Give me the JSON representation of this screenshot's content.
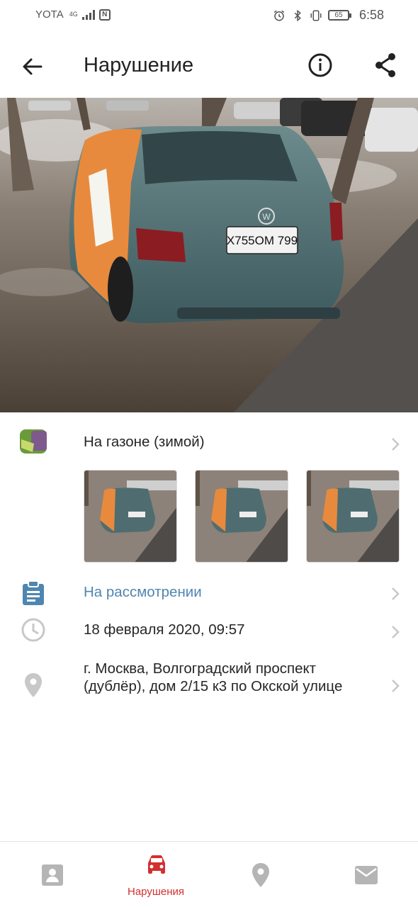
{
  "status_bar": {
    "carrier": "YOTA",
    "network_type": "4G",
    "battery": "65",
    "time": "6:58"
  },
  "app_bar": {
    "title": "Нарушение"
  },
  "violation": {
    "type_label": "На газоне (зимой)",
    "status": "На рассмотрении",
    "datetime": "18 февраля 2020, 09:57",
    "address": "г. Москва, Волгоградский проспект (дублёр), дом 2/15 к3 по Окской улице",
    "plate": "X755OM 799"
  },
  "photo_count": 3,
  "bottom_nav": {
    "items": [
      {
        "icon": "profile-icon",
        "label": ""
      },
      {
        "icon": "car-icon",
        "label": "Нарушения",
        "active": true
      },
      {
        "icon": "map-pin-icon",
        "label": ""
      },
      {
        "icon": "mail-icon",
        "label": ""
      }
    ]
  },
  "colors": {
    "accent_red": "#d32f2f",
    "status_blue": "#4f86b0",
    "icon_gray": "#c8c8c8"
  }
}
